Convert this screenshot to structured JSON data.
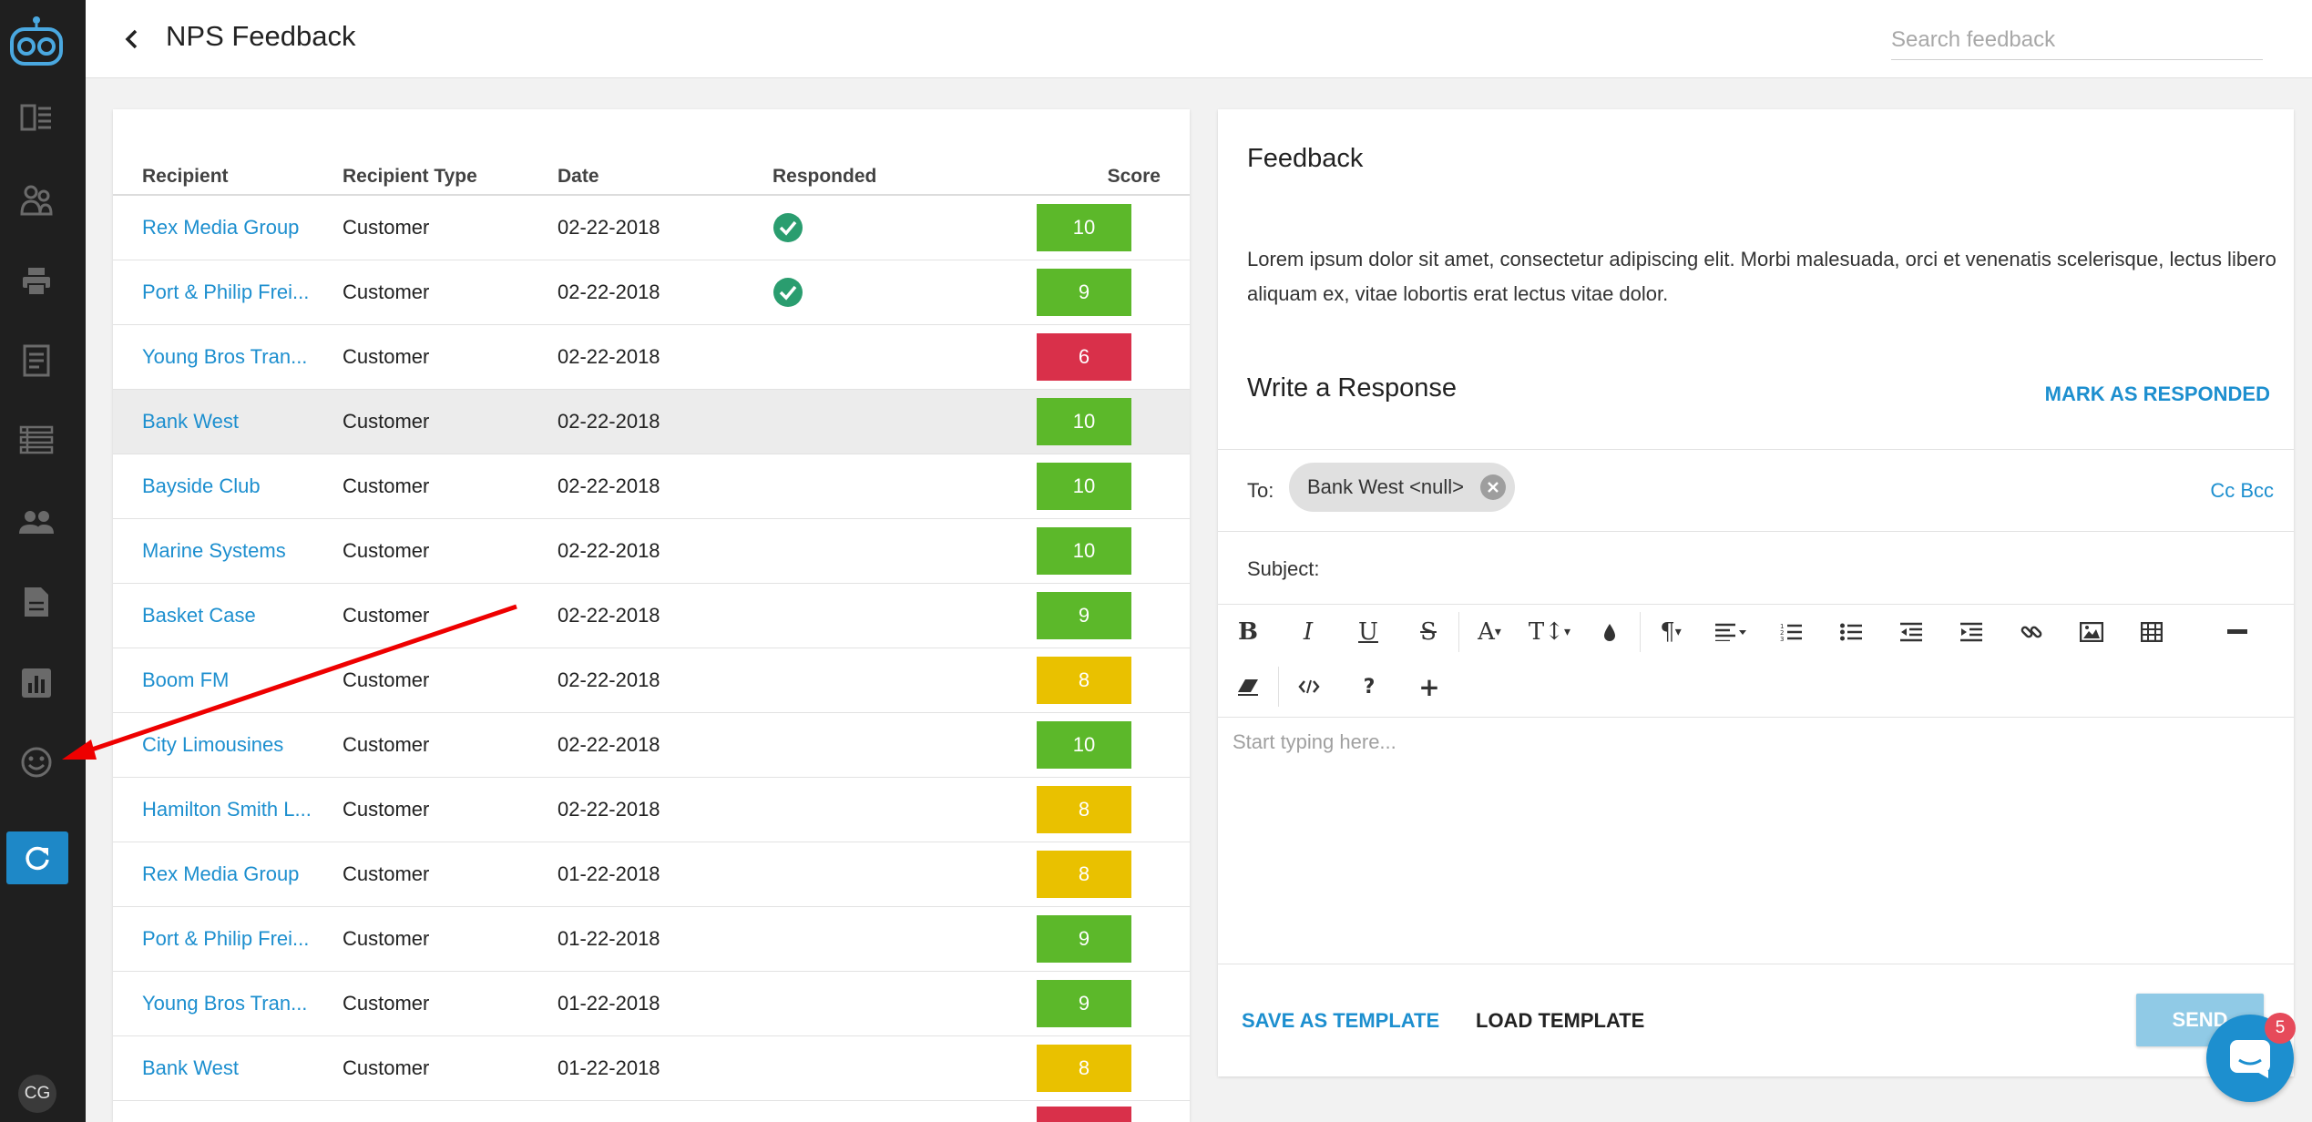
{
  "header": {
    "title": "NPS Feedback",
    "search_placeholder": "Search feedback"
  },
  "sidebar": {
    "avatar_initials": "CG",
    "icons": [
      "robot-logo-icon",
      "dashboard-icon",
      "contacts-icon",
      "printer-icon",
      "document-icon",
      "list-icon",
      "people-icon",
      "file-icon",
      "bar-chart-icon",
      "smiley-icon",
      "refresh-icon"
    ]
  },
  "table": {
    "headers": {
      "recipient": "Recipient",
      "recipient_type": "Recipient Type",
      "date": "Date",
      "responded": "Responded",
      "score": "Score"
    },
    "rows": [
      {
        "recipient": "Rex Media Group",
        "type": "Customer",
        "date": "02-22-2018",
        "responded": true,
        "score": "10",
        "color": "#5cb82a"
      },
      {
        "recipient": "Port & Philip Frei...",
        "type": "Customer",
        "date": "02-22-2018",
        "responded": true,
        "score": "9",
        "color": "#5cb82a"
      },
      {
        "recipient": "Young Bros Tran...",
        "type": "Customer",
        "date": "02-22-2018",
        "responded": false,
        "score": "6",
        "color": "#d9304a"
      },
      {
        "recipient": "Bank West",
        "type": "Customer",
        "date": "02-22-2018",
        "responded": false,
        "score": "10",
        "color": "#5cb82a"
      },
      {
        "recipient": "Bayside Club",
        "type": "Customer",
        "date": "02-22-2018",
        "responded": false,
        "score": "10",
        "color": "#5cb82a"
      },
      {
        "recipient": "Marine Systems",
        "type": "Customer",
        "date": "02-22-2018",
        "responded": false,
        "score": "10",
        "color": "#5cb82a"
      },
      {
        "recipient": "Basket Case",
        "type": "Customer",
        "date": "02-22-2018",
        "responded": false,
        "score": "9",
        "color": "#5cb82a"
      },
      {
        "recipient": "Boom FM",
        "type": "Customer",
        "date": "02-22-2018",
        "responded": false,
        "score": "8",
        "color": "#e9c100"
      },
      {
        "recipient": "City Limousines",
        "type": "Customer",
        "date": "02-22-2018",
        "responded": false,
        "score": "10",
        "color": "#5cb82a"
      },
      {
        "recipient": "Hamilton Smith L...",
        "type": "Customer",
        "date": "02-22-2018",
        "responded": false,
        "score": "8",
        "color": "#e9c100"
      },
      {
        "recipient": "Rex Media Group",
        "type": "Customer",
        "date": "01-22-2018",
        "responded": false,
        "score": "8",
        "color": "#e9c100"
      },
      {
        "recipient": "Port & Philip Frei...",
        "type": "Customer",
        "date": "01-22-2018",
        "responded": false,
        "score": "9",
        "color": "#5cb82a"
      },
      {
        "recipient": "Young Bros Tran...",
        "type": "Customer",
        "date": "01-22-2018",
        "responded": false,
        "score": "9",
        "color": "#5cb82a"
      },
      {
        "recipient": "Bank West",
        "type": "Customer",
        "date": "01-22-2018",
        "responded": false,
        "score": "8",
        "color": "#e9c100"
      },
      {
        "recipient": "",
        "type": "",
        "date": "",
        "responded": false,
        "score": "",
        "color": "#d9304a"
      }
    ],
    "selected_index": 3
  },
  "feedback": {
    "title": "Feedback",
    "body": "Lorem ipsum dolor sit amet, consectetur adipiscing elit. Morbi malesuada, orci et venenatis scelerisque, lectus libero aliquam ex, vitae lobortis erat lectus vitae dolor.",
    "response_title": "Write a Response",
    "mark_responded": "MARK AS RESPONDED",
    "to_label": "To:",
    "to_chip": "Bank West <null>",
    "cc_bcc": "Cc Bcc",
    "subject_label": "Subject:",
    "editor_placeholder": "Start typing here...",
    "save_template": "SAVE AS TEMPLATE",
    "load_template": "LOAD TEMPLATE",
    "send": "SEND"
  },
  "chat": {
    "badge_count": "5"
  },
  "colors": {
    "accent": "#1d8fcf",
    "score_green": "#5cb82a",
    "score_yellow": "#e9c100",
    "score_red": "#d9304a",
    "annotation_arrow": "#ee0000"
  }
}
